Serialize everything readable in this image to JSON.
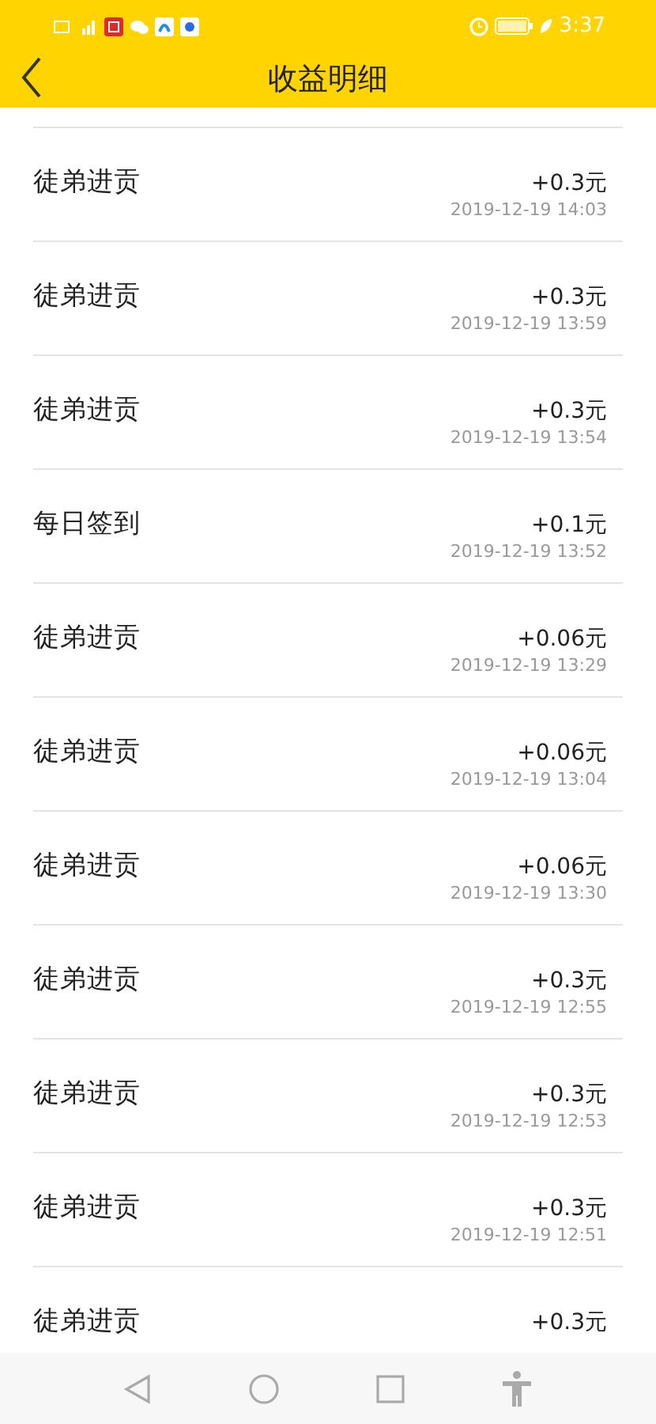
{
  "status_bar": {
    "time": "3:37"
  },
  "header": {
    "title": "收益明细"
  },
  "records": [
    {
      "title": "徒弟进贡",
      "amount": "+0.3元",
      "time": "2019-12-19 14:03"
    },
    {
      "title": "徒弟进贡",
      "amount": "+0.3元",
      "time": "2019-12-19 13:59"
    },
    {
      "title": "徒弟进贡",
      "amount": "+0.3元",
      "time": "2019-12-19 13:54"
    },
    {
      "title": "每日签到",
      "amount": "+0.1元",
      "time": "2019-12-19 13:52"
    },
    {
      "title": "徒弟进贡",
      "amount": "+0.06元",
      "time": "2019-12-19 13:29"
    },
    {
      "title": "徒弟进贡",
      "amount": "+0.06元",
      "time": "2019-12-19 13:04"
    },
    {
      "title": "徒弟进贡",
      "amount": "+0.06元",
      "time": "2019-12-19 13:30"
    },
    {
      "title": "徒弟进贡",
      "amount": "+0.3元",
      "time": "2019-12-19 12:55"
    },
    {
      "title": "徒弟进贡",
      "amount": "+0.3元",
      "time": "2019-12-19 12:53"
    },
    {
      "title": "徒弟进贡",
      "amount": "+0.3元",
      "time": "2019-12-19 12:51"
    },
    {
      "title": "徒弟进贡",
      "amount": "+0.3元"
    }
  ]
}
